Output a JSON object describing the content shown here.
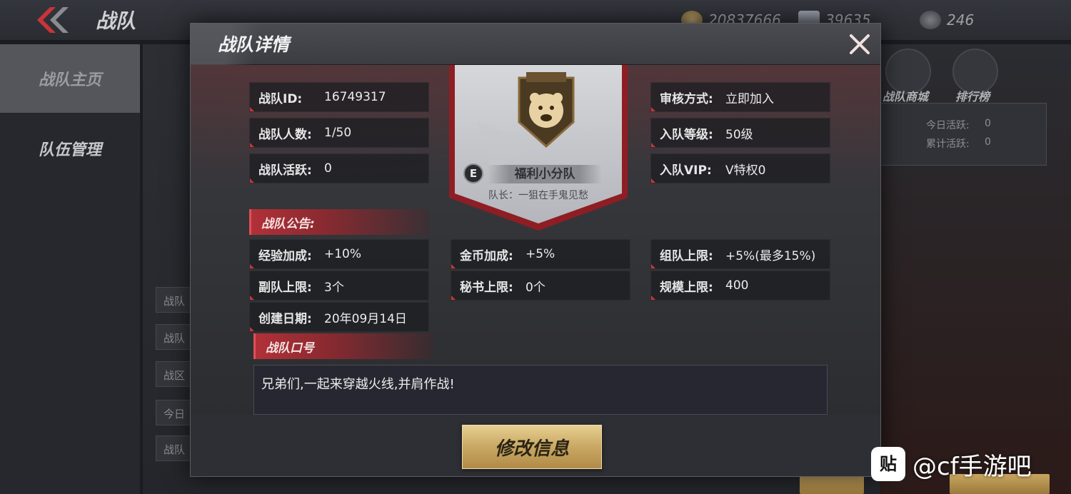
{
  "background": {
    "title": "战队",
    "resources": [
      {
        "icon": "gold-coin-icon",
        "value": "20837666"
      },
      {
        "icon": "diamond-icon",
        "value": "39635"
      },
      {
        "icon": "rank-badge-icon",
        "value": "246"
      }
    ],
    "sidebar": [
      {
        "label": "战队主页"
      },
      {
        "label": "队伍管理"
      }
    ],
    "shortcuts": [
      {
        "label": "战队商城"
      },
      {
        "label": "排行榜"
      }
    ],
    "activity": {
      "today_label": "今日活跃:",
      "today_value": "0",
      "total_label": "累计活跃:",
      "total_value": "0"
    },
    "list_items": [
      "战队",
      "战队",
      "战区",
      "今日",
      "战队"
    ]
  },
  "dialog": {
    "title": "战队详情",
    "fields_left": [
      {
        "label": "战队ID:",
        "value": "16749317"
      },
      {
        "label": "战队人数:",
        "value": "1/50"
      },
      {
        "label": "战队活跃:",
        "value": "0"
      }
    ],
    "fields_right": [
      {
        "label": "审核方式:",
        "value": "立即加入"
      },
      {
        "label": "入队等级:",
        "value": "50级"
      },
      {
        "label": "入队VIP:",
        "value": "V特权0"
      }
    ],
    "emblem": {
      "badge": "E",
      "team_name": "福利小分队",
      "captain": "队长：一狙在手鬼见愁"
    },
    "announcement_header": "战队公告:",
    "bonuses": [
      {
        "label": "经验加成:",
        "value": "+10%"
      },
      {
        "label": "金币加成:",
        "value": "+5%"
      },
      {
        "label": "组队上限:",
        "value": "+5%(最多15%)"
      },
      {
        "label": "副队上限:",
        "value": "3个"
      },
      {
        "label": "秘书上限:",
        "value": "0个"
      },
      {
        "label": "规模上限:",
        "value": "400"
      },
      {
        "label": "创建日期:",
        "value": "20年09月14日"
      }
    ],
    "slogan_header": "战队口号",
    "slogan": "兄弟们,一起来穿越火线,并肩作战!",
    "edit_button": "修改信息"
  },
  "watermark": {
    "logo": "贴",
    "text": "@cf手游吧"
  },
  "colors": {
    "accent_red": "#c8343a",
    "gold": "#c9a862",
    "panel": "#2f3035"
  }
}
